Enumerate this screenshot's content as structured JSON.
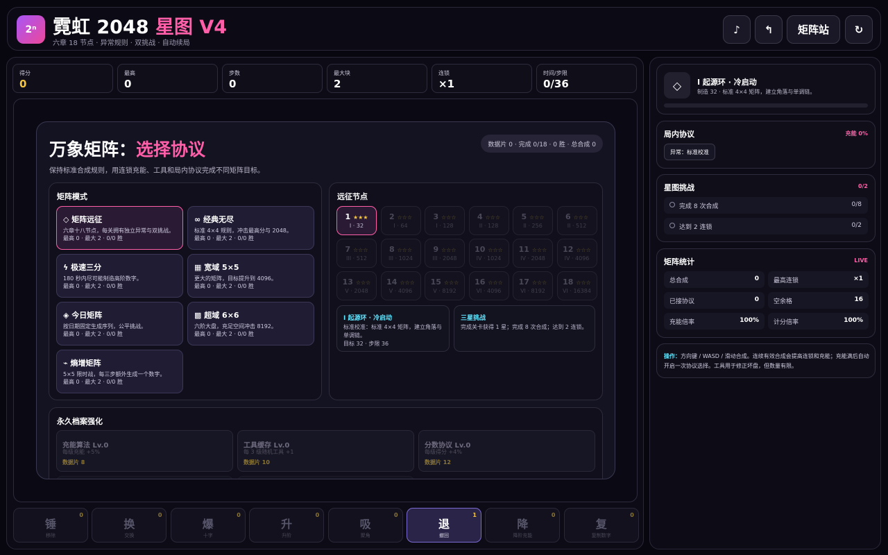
{
  "header": {
    "logo": "2ⁿ",
    "title_main": "霓虹 2048 ",
    "title_accent": "星图 V4",
    "subtitle": "六章 18 节点 · 异常规则 · 双挑战 · 自动续局",
    "buttons": {
      "music": "♪",
      "undo": "↰",
      "station": "矩阵站",
      "restart": "↻"
    }
  },
  "stats": [
    {
      "label": "得分",
      "value": "0",
      "color": "#f5c542"
    },
    {
      "label": "最高",
      "value": "0"
    },
    {
      "label": "步数",
      "value": "0"
    },
    {
      "label": "最大块",
      "value": "2"
    },
    {
      "label": "连锁",
      "value": "×1"
    },
    {
      "label": "时间/步限",
      "value": "0/36"
    }
  ],
  "modal": {
    "title_main": "万象矩阵：",
    "title_accent": "选择协议",
    "pill": "数据片 0 · 完成 0/18 · 0 胜 · 总合成 0",
    "desc": "保持标准合成规则，用连锁充能、工具和局内协议完成不同矩阵目标。",
    "modes_heading": "矩阵模式",
    "modes": [
      {
        "title": "◇ 矩阵远征",
        "desc": "六章十八节点，每关拥有独立异常与双挑战。",
        "stat": "最高 0 · 最大 2 · 0/0 胜"
      },
      {
        "title": "∞ 经典无尽",
        "desc": "标准 4×4 规则，冲击最高分与 2048。",
        "stat": "最高 0 · 最大 2 · 0/0 胜"
      },
      {
        "title": "ϟ 极速三分",
        "desc": "180 秒内尽可能制造高阶数字。",
        "stat": "最高 0 · 最大 2 · 0/0 胜"
      },
      {
        "title": "▦ 宽域 5×5",
        "desc": "更大的矩阵，目标提升到 4096。",
        "stat": "最高 0 · 最大 2 · 0/0 胜"
      },
      {
        "title": "◈ 今日矩阵",
        "desc": "按日期固定生成序列，公平挑战。",
        "stat": "最高 0 · 最大 2 · 0/0 胜"
      },
      {
        "title": "▩ 超域 6×6",
        "desc": "六阶大盘，充足空间冲击 8192。",
        "stat": "最高 0 · 最大 2 · 0/0 胜"
      },
      {
        "title": "⌁ 熵增矩阵",
        "desc": "5×5 限时战，每三步额外生成一个数字。",
        "stat": "最高 0 · 最大 2 · 0/0 胜"
      }
    ],
    "nodes_heading": "远征节点",
    "nodes": [
      {
        "num": "1",
        "stars": "★★★",
        "sub": "I · 32"
      },
      {
        "num": "2",
        "stars": "☆☆☆",
        "sub": "I · 64"
      },
      {
        "num": "3",
        "stars": "☆☆☆",
        "sub": "I · 128"
      },
      {
        "num": "4",
        "stars": "☆☆☆",
        "sub": "II · 128"
      },
      {
        "num": "5",
        "stars": "☆☆☆",
        "sub": "II · 256"
      },
      {
        "num": "6",
        "stars": "☆☆☆",
        "sub": "II · 512"
      },
      {
        "num": "7",
        "stars": "☆☆☆",
        "sub": "III · 512"
      },
      {
        "num": "8",
        "stars": "☆☆☆",
        "sub": "III · 1024"
      },
      {
        "num": "9",
        "stars": "☆☆☆",
        "sub": "III · 2048"
      },
      {
        "num": "10",
        "stars": "☆☆☆",
        "sub": "IV · 1024"
      },
      {
        "num": "11",
        "stars": "☆☆☆",
        "sub": "IV · 2048"
      },
      {
        "num": "12",
        "stars": "☆☆☆",
        "sub": "IV · 4096"
      },
      {
        "num": "13",
        "stars": "☆☆☆",
        "sub": "V · 2048"
      },
      {
        "num": "14",
        "stars": "☆☆☆",
        "sub": "V · 4096"
      },
      {
        "num": "15",
        "stars": "☆☆☆",
        "sub": "V · 8192"
      },
      {
        "num": "16",
        "stars": "☆☆☆",
        "sub": "VI · 4096"
      },
      {
        "num": "17",
        "stars": "☆☆☆",
        "sub": "VI · 8192"
      },
      {
        "num": "18",
        "stars": "☆☆☆",
        "sub": "VI · 16384"
      }
    ],
    "node_info": {
      "title": "I 起源环 · 冷启动",
      "line1": "标准校准：标准 4×4 矩阵，建立角落与",
      "line2": "单调链。",
      "line3": "目标 32 · 步限 36"
    },
    "challenge_info": {
      "title": "三星挑战",
      "line1": "完成关卡获得 1 星；完成 8 次合成；达到 2 连锁。"
    },
    "upgrades_heading": "永久档案强化",
    "upgrades": [
      {
        "title": "充能算法 Lv.0",
        "desc": "每级充能 +5%",
        "cost": "数据片 8"
      },
      {
        "title": "工具缓存 Lv.0",
        "desc": "每 3 级随机工具 +1",
        "cost": "数据片 10"
      },
      {
        "title": "分数协议 Lv.0",
        "desc": "每级得分 +4%",
        "cost": "数据片 12"
      }
    ]
  },
  "tools": [
    {
      "glyph": "锤",
      "label": "移除",
      "count": "0"
    },
    {
      "glyph": "换",
      "label": "交换",
      "count": "0"
    },
    {
      "glyph": "爆",
      "label": "十字",
      "count": "0"
    },
    {
      "glyph": "升",
      "label": "升阶",
      "count": "0"
    },
    {
      "glyph": "吸",
      "label": "聚角",
      "count": "0"
    },
    {
      "glyph": "退",
      "label": "撤回",
      "count": "1"
    },
    {
      "glyph": "降",
      "label": "降阶充能",
      "count": "0"
    },
    {
      "glyph": "复",
      "label": "复制数字",
      "count": "0"
    }
  ],
  "sidebar": {
    "level": {
      "icon": "◇",
      "title": "I 起源环 · 冷启动",
      "desc": "制造 32 · 标准 4×4 矩阵，建立角落与单调链。",
      "progress": 0
    },
    "protocol": {
      "heading": "局内协议",
      "badge": "充能 0%",
      "tag": "异常：标准校准"
    },
    "challenges": {
      "heading": "星图挑战",
      "badge": "0/2",
      "items": [
        {
          "label": "完成 8 次合成",
          "value": "0/8"
        },
        {
          "label": "达到 2 连锁",
          "value": "0/2"
        }
      ]
    },
    "stats": {
      "heading": "矩阵统计",
      "badge": "LIVE",
      "items": [
        {
          "label": "总合成",
          "value": "0"
        },
        {
          "label": "最高连锁",
          "value": "×1"
        },
        {
          "label": "已接协议",
          "value": "0"
        },
        {
          "label": "空余格",
          "value": "16"
        },
        {
          "label": "充能倍率",
          "value": "100%"
        },
        {
          "label": "计分倍率",
          "value": "100%"
        }
      ]
    },
    "help": {
      "key": "操作：",
      "text": "方向键 / WASD / 滑动合成。连续有效合成会提高连锁和充能；充能满后自动开启一次协议选择。工具用于修正坏盘，但数量有限。"
    }
  },
  "colors": {
    "accent": "#ff5fa8",
    "cyan": "#5ee6ff",
    "gold": "#f5c542",
    "panel": "#0d0c16"
  }
}
